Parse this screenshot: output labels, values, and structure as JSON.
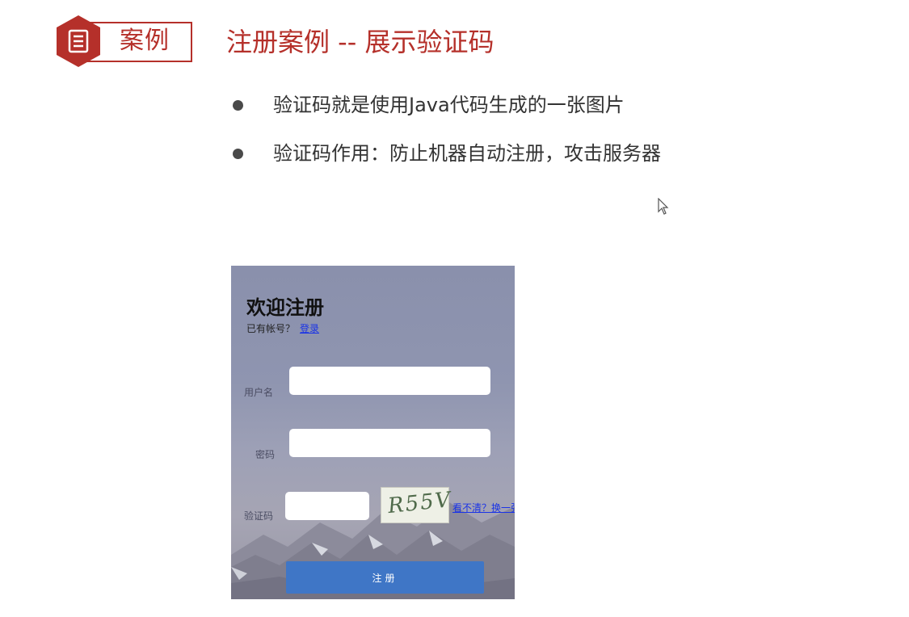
{
  "header": {
    "badge_label": "案例",
    "title": "注册案例 -- 展示验证码"
  },
  "bullets": [
    "验证码就是使用Java代码生成的一张图片",
    "验证码作用：防止机器自动注册，攻击服务器"
  ],
  "form": {
    "welcome": "欢迎注册",
    "has_account": "已有帐号？",
    "login_link": "登录",
    "username_label": "用户名",
    "password_label": "密码",
    "captcha_label": "验证码",
    "captcha_text": "R55V",
    "refresh_link": "看不清？换一张",
    "register_button": "注册"
  },
  "colors": {
    "accent": "#b5302a",
    "button": "#3f76c6",
    "link": "#1a33e6"
  }
}
